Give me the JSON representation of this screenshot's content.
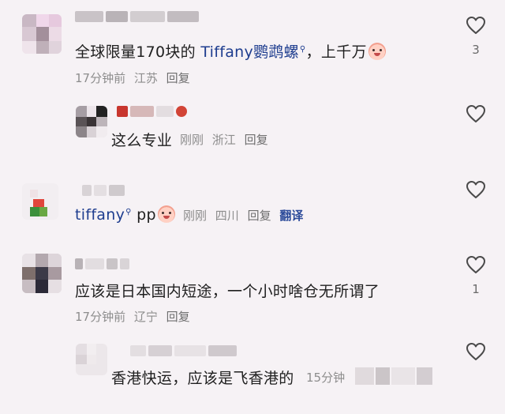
{
  "comments": [
    {
      "text_before": "全球限量170块的 ",
      "link": "Tiffany鹦鹉螺",
      "text_after": "，上千万",
      "time": "17分钟前",
      "location": "江苏",
      "reply": "回复",
      "likes": "3"
    },
    {
      "text": "这么专业",
      "time": "刚刚",
      "location": "浙江",
      "reply": "回复",
      "likes": ""
    },
    {
      "link": "tiffany",
      "text_after": " pp",
      "time": "刚刚",
      "location": "四川",
      "reply": "回复",
      "translate": "翻译",
      "likes": ""
    },
    {
      "text": "应该是日本国内短途，一个小时啥仓无所谓了",
      "time": "17分钟前",
      "location": "辽宁",
      "reply": "回复",
      "likes": "1"
    },
    {
      "text": "香港快运，应该是飞香港的",
      "time": "15分钟",
      "likes": ""
    }
  ],
  "icons": {
    "like": "heart-outline-icon",
    "search": "search-icon",
    "emoji": "crying-face-emoji"
  },
  "colors": {
    "background": "#f6f2f5",
    "link": "#1e3d8f",
    "meta": "#8d8d8d"
  }
}
